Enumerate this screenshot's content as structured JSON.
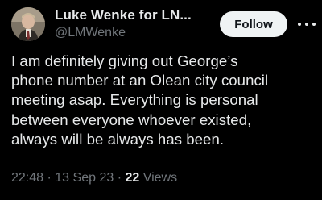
{
  "author": {
    "display_name": "Luke Wenke for LN...",
    "handle": "@LMWenke",
    "avatar_icon": "profile-photo"
  },
  "actions": {
    "follow_label": "Follow",
    "more_icon": "more-options-icon"
  },
  "tweet": {
    "text": "I am definitely giving out George’s\nphone number at an Olean city council\nmeeting asap.  Everything is personal\nbetween everyone whoever existed,\nalways will be always has been."
  },
  "meta": {
    "time": "22:48",
    "separator": "·",
    "date": "13 Sep 23",
    "views_count": "22",
    "views_label": "Views"
  },
  "colors": {
    "background": "#000000",
    "primary_text": "#e7e9ea",
    "secondary_text": "#71767b",
    "follow_button_bg": "#eff3f4"
  }
}
